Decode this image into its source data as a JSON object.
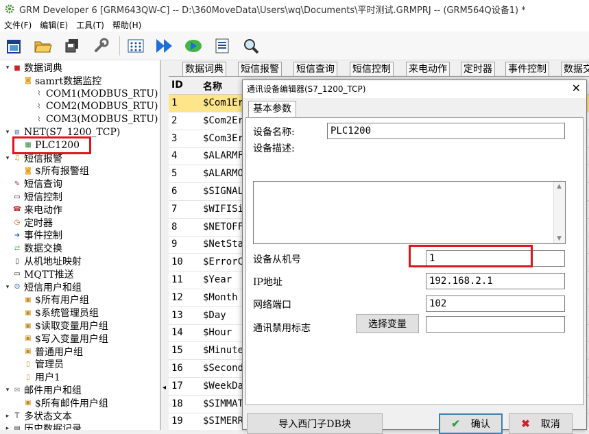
{
  "window": {
    "title": "GRM Developer 6 [GRM643QW-C]  -- D:\\360MoveData\\Users\\wq\\Documents\\平时测试.GRMPRJ -- (GRM564Q设备1) *"
  },
  "menu": [
    "文件(F)",
    "编辑(E)",
    "工具(T)",
    "帮助(H)"
  ],
  "tree": {
    "items": [
      {
        "label": "数据词典",
        "icon": "book-icon",
        "expand": "▾"
      },
      {
        "label": "samrt数据监控",
        "icon": "monitor-icon",
        "expand": ""
      },
      {
        "label": "COM1(MODBUS_RTU)",
        "icon": "serial-port-icon",
        "expand": ""
      },
      {
        "label": "COM2(MODBUS_RTU)",
        "icon": "serial-port-icon",
        "expand": ""
      },
      {
        "label": "COM3(MODBUS_RTU)",
        "icon": "serial-port-icon",
        "expand": ""
      },
      {
        "label": "NET(S7_1200_TCP)",
        "icon": "network-icon",
        "expand": "▾"
      },
      {
        "label": "PLC1200",
        "icon": "plc-icon",
        "expand": ""
      },
      {
        "label": "短信报警",
        "icon": "bell-icon",
        "expand": "▾"
      },
      {
        "label": "$所有报警组",
        "icon": "alarm-group-icon",
        "expand": ""
      },
      {
        "label": "短信查询",
        "icon": "query-icon",
        "expand": ""
      },
      {
        "label": "短信控制",
        "icon": "sms-control-icon",
        "expand": ""
      },
      {
        "label": "来电动作",
        "icon": "phone-icon",
        "expand": ""
      },
      {
        "label": "定时器",
        "icon": "clock-icon",
        "expand": ""
      },
      {
        "label": "事件控制",
        "icon": "event-icon",
        "expand": ""
      },
      {
        "label": "数据交换",
        "icon": "exchange-icon",
        "expand": ""
      },
      {
        "label": "从机地址映射",
        "icon": "address-map-icon",
        "expand": ""
      },
      {
        "label": "MQTT推送",
        "icon": "mqtt-icon",
        "expand": ""
      },
      {
        "label": "短信用户和组",
        "icon": "users-icon",
        "expand": "▾"
      },
      {
        "label": "$所有用户组",
        "icon": "user-group-icon",
        "expand": ""
      },
      {
        "label": "$系统管理员组",
        "icon": "user-group-icon",
        "expand": ""
      },
      {
        "label": "$读取变量用户组",
        "icon": "user-group-icon",
        "expand": ""
      },
      {
        "label": "$写入变量用户组",
        "icon": "user-group-icon",
        "expand": ""
      },
      {
        "label": "普通用户组",
        "icon": "user-group-icon",
        "expand": ""
      },
      {
        "label": "管理员",
        "icon": "user-icon",
        "expand": ""
      },
      {
        "label": "用户1",
        "icon": "user-icon",
        "expand": ""
      },
      {
        "label": "邮件用户和组",
        "icon": "mail-icon",
        "expand": "▾"
      },
      {
        "label": "$所有邮件用户组",
        "icon": "user-group-icon",
        "expand": ""
      },
      {
        "label": "多状态文本",
        "icon": "text-icon",
        "expand": "▸"
      },
      {
        "label": "历史数据记录",
        "icon": "history-icon",
        "expand": "▸"
      }
    ]
  },
  "tabs": [
    "数据词典",
    "短信报警",
    "短信查询",
    "短信控制",
    "来电动作",
    "定时器",
    "事件控制",
    "数据交"
  ],
  "grid": {
    "headers": [
      "ID",
      "名称"
    ],
    "rows": [
      [
        "1",
        "$Com1Er"
      ],
      [
        "2",
        "$Com2Er"
      ],
      [
        "3",
        "$Com3Er"
      ],
      [
        "4",
        "$ALARMF"
      ],
      [
        "5",
        "$ALARMO"
      ],
      [
        "6",
        "$SIGNAL"
      ],
      [
        "7",
        "$WIFISi"
      ],
      [
        "8",
        "$NETOFF"
      ],
      [
        "9",
        "$NetSta"
      ],
      [
        "10",
        "$ErrorC"
      ],
      [
        "11",
        "$Year"
      ],
      [
        "12",
        "$Month"
      ],
      [
        "13",
        "$Day"
      ],
      [
        "14",
        "$Hour"
      ],
      [
        "15",
        "$Minute"
      ],
      [
        "16",
        "$Second"
      ],
      [
        "17",
        "$WeekDa"
      ],
      [
        "18",
        "$SIMMAT"
      ],
      [
        "19",
        "$SIMERR"
      ]
    ]
  },
  "dialog": {
    "title": "通讯设备编辑器(S7_1200_TCP)",
    "close": "✕",
    "tab": "基本参数",
    "device_name_label": "设备名称:",
    "device_name_value": "PLC1200",
    "description_label": "设备描述:",
    "slave_label": "设备从机号",
    "slave_value": "1",
    "ip_label": "IP地址",
    "ip_value": "192.168.2.1",
    "port_label": "网络端口",
    "port_value": "102",
    "disable_label": "通讯禁用标志",
    "select_var_button": "选择变量",
    "disable_value": "",
    "import_button": "导入西门子DB块",
    "ok_button": "确认",
    "cancel_button": "取消"
  },
  "colors": {
    "selected_row": "#ffe58a",
    "highlight_box": "#e0141e",
    "ok_check": "#2e9e3e",
    "cancel_x": "#d0202a"
  }
}
